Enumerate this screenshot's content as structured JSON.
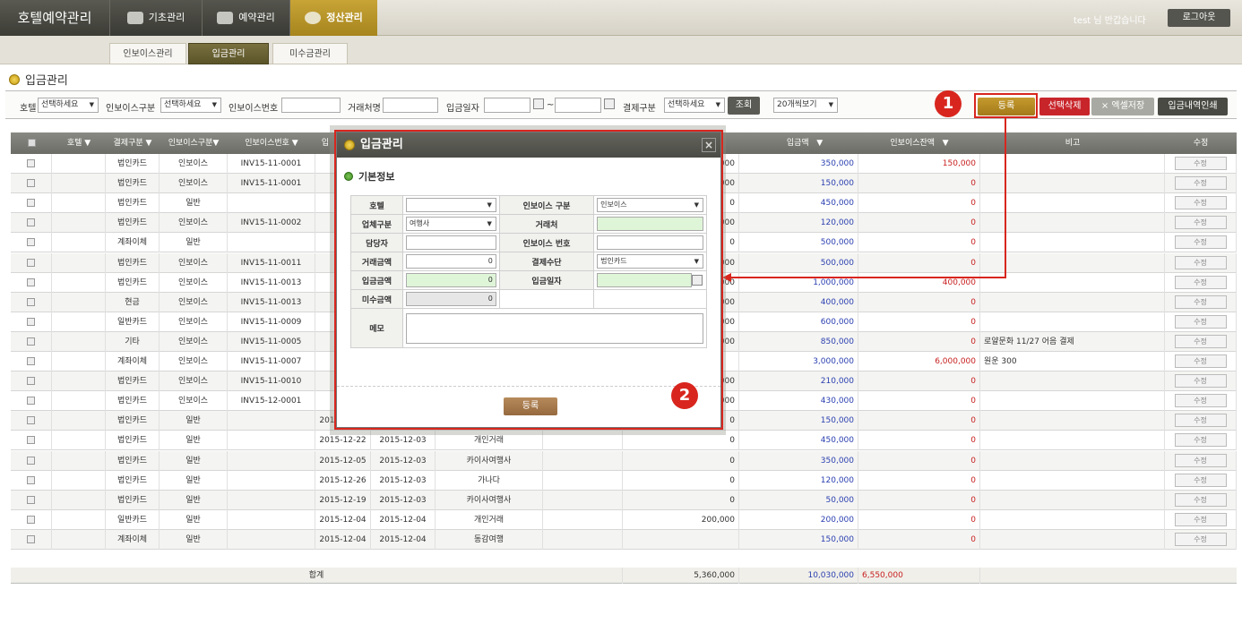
{
  "app": {
    "title": "호텔예약관리",
    "greeting": "test 님 반갑습니다",
    "logout": "로그아웃"
  },
  "topnav": [
    {
      "label": "기초관리",
      "icon": "gear-icon"
    },
    {
      "label": "예약관리",
      "icon": "bed-icon"
    },
    {
      "label": "정산관리",
      "icon": "coins-icon"
    }
  ],
  "subtabs": [
    "인보이스관리",
    "입금관리",
    "미수금관리"
  ],
  "page_title": "입금관리",
  "filters": {
    "hotel_label": "호텔",
    "hotel_value": "선택하세요",
    "invoice_type_label": "인보이스구분",
    "invoice_type_value": "선택하세요",
    "invoice_no_label": "인보이스번호",
    "partner_label": "거래처명",
    "date_label": "입금일자",
    "date_sep": "~",
    "pay_type_label": "결제구분",
    "pay_type_value": "선택하세요",
    "search_button": "조회",
    "page_size_value": "20개씩보기"
  },
  "actions": {
    "register": "등록",
    "delete_selected": "선택삭제",
    "excel": "× 엑셀저장",
    "print": "입금내역인쇄"
  },
  "annotations": {
    "one": "1",
    "two": "2"
  },
  "table": {
    "headers": [
      "호텔",
      "결제구분",
      "인보이스구분",
      "인보이스번호",
      "입",
      "입금액",
      "인보이스잔액",
      "비고",
      "수정"
    ],
    "rows": [
      {
        "pay": "법인카드",
        "inv": "인보이스",
        "no": "INV15-11-0001",
        "year": "201",
        "d2": "",
        "cust": "",
        "cat": "",
        "pre": "000",
        "amt": "350,000",
        "bal": "150,000",
        "note": ""
      },
      {
        "pay": "법인카드",
        "inv": "인보이스",
        "no": "INV15-11-0001",
        "year": "201",
        "d2": "",
        "cust": "",
        "cat": "",
        "pre": "000",
        "amt": "150,000",
        "bal": "0",
        "note": ""
      },
      {
        "pay": "법인카드",
        "inv": "일반",
        "no": "",
        "year": "201",
        "d2": "",
        "cust": "",
        "cat": "",
        "pre": "0",
        "amt": "450,000",
        "bal": "0",
        "note": ""
      },
      {
        "pay": "법인카드",
        "inv": "인보이스",
        "no": "INV15-11-0002",
        "year": "201",
        "d2": "",
        "cust": "",
        "cat": "",
        "pre": "000",
        "amt": "120,000",
        "bal": "0",
        "note": ""
      },
      {
        "pay": "계좌이체",
        "inv": "일반",
        "no": "",
        "year": "201",
        "d2": "",
        "cust": "",
        "cat": "",
        "pre": "0",
        "amt": "500,000",
        "bal": "0",
        "note": ""
      },
      {
        "pay": "법인카드",
        "inv": "인보이스",
        "no": "INV15-11-0011",
        "year": "201",
        "d2": "",
        "cust": "",
        "cat": "",
        "pre": "000",
        "amt": "500,000",
        "bal": "0",
        "note": ""
      },
      {
        "pay": "법인카드",
        "inv": "인보이스",
        "no": "INV15-11-0013",
        "year": "201",
        "d2": "",
        "cust": "",
        "cat": "",
        "pre": "000",
        "amt": "1,000,000",
        "bal": "400,000",
        "note": ""
      },
      {
        "pay": "현금",
        "inv": "인보이스",
        "no": "INV15-11-0013",
        "year": "201",
        "d2": "",
        "cust": "",
        "cat": "",
        "pre": "000",
        "amt": "400,000",
        "bal": "0",
        "note": ""
      },
      {
        "pay": "일반카드",
        "inv": "인보이스",
        "no": "INV15-11-0009",
        "year": "201",
        "d2": "",
        "cust": "",
        "cat": "",
        "pre": "000",
        "amt": "600,000",
        "bal": "0",
        "note": ""
      },
      {
        "pay": "기타",
        "inv": "인보이스",
        "no": "INV15-11-0005",
        "year": "201",
        "d2": "",
        "cust": "",
        "cat": "",
        "pre": "000",
        "amt": "850,000",
        "bal": "0",
        "note": "로얄문화 11/27 어음 결제"
      },
      {
        "pay": "계좌이체",
        "inv": "인보이스",
        "no": "INV15-11-0007",
        "year": "201",
        "d2": "",
        "cust": "",
        "cat": "",
        "pre": "",
        "amt": "3,000,000",
        "bal": "6,000,000",
        "note": "원운 300"
      },
      {
        "pay": "법인카드",
        "inv": "인보이스",
        "no": "INV15-11-0010",
        "year": "201",
        "d2": "",
        "cust": "",
        "cat": "",
        "pre": "000",
        "amt": "210,000",
        "bal": "0",
        "note": ""
      },
      {
        "pay": "법인카드",
        "inv": "인보이스",
        "no": "INV15-12-0001",
        "year": "201",
        "d2": "",
        "cust": "",
        "cat": "",
        "pre": "000",
        "amt": "430,000",
        "bal": "0",
        "note": ""
      },
      {
        "pay": "법인카드",
        "inv": "일반",
        "no": "",
        "year": "2015-12-26",
        "d2": "2015-12-03",
        "cust": "개인",
        "cat": "개인 입금",
        "pre": "0",
        "amt": "150,000",
        "bal": "0",
        "note": ""
      },
      {
        "pay": "법인카드",
        "inv": "일반",
        "no": "",
        "year": "2015-12-22",
        "d2": "2015-12-03",
        "cust": "개인거래",
        "cat": "",
        "pre": "0",
        "amt": "450,000",
        "bal": "0",
        "note": ""
      },
      {
        "pay": "법인카드",
        "inv": "일반",
        "no": "",
        "year": "2015-12-05",
        "d2": "2015-12-03",
        "cust": "카이사여행사",
        "cat": "",
        "pre": "0",
        "amt": "350,000",
        "bal": "0",
        "note": ""
      },
      {
        "pay": "법인카드",
        "inv": "일반",
        "no": "",
        "year": "2015-12-26",
        "d2": "2015-12-03",
        "cust": "가나다",
        "cat": "",
        "pre": "0",
        "amt": "120,000",
        "bal": "0",
        "note": ""
      },
      {
        "pay": "법인카드",
        "inv": "일반",
        "no": "",
        "year": "2015-12-19",
        "d2": "2015-12-03",
        "cust": "카이사여행사",
        "cat": "",
        "pre": "0",
        "amt": "50,000",
        "bal": "0",
        "note": ""
      },
      {
        "pay": "일반카드",
        "inv": "일반",
        "no": "",
        "year": "2015-12-04",
        "d2": "2015-12-04",
        "cust": "개인거래",
        "cat": "",
        "pre": "200,000",
        "amt": "200,000",
        "bal": "0",
        "note": ""
      },
      {
        "pay": "계좌이체",
        "inv": "일반",
        "no": "",
        "year": "2015-12-04",
        "d2": "2015-12-04",
        "cust": "동감여행",
        "cat": "",
        "pre": "",
        "amt": "150,000",
        "bal": "0",
        "note": ""
      }
    ],
    "edit_label": "수정",
    "total": {
      "label": "합계",
      "pre": "5,360,000",
      "amt": "10,030,000",
      "bal": "6,550,000"
    }
  },
  "modal": {
    "title": "입금관리",
    "close": "×",
    "section": "기본정보",
    "hotel_label": "호텔",
    "hotel_value": "",
    "invoice_type_label": "인보이스 구분",
    "invoice_type_value": "인보이스",
    "biz_type_label": "업체구분",
    "biz_type_value": "여행사",
    "partner_label": "거래처",
    "partner_value": "",
    "manager_label": "담당자",
    "manager_value": "",
    "invoice_no_label": "인보이스 번호",
    "invoice_no_value": "",
    "trade_amount_label": "거래금액",
    "trade_amount_value": "0",
    "pay_method_label": "결제수단",
    "pay_method_value": "법인카드",
    "deposit_amount_label": "입금금액",
    "deposit_amount_value": "0",
    "deposit_date_label": "입금일자",
    "deposit_date_value": "",
    "unpaid_label": "미수금액",
    "unpaid_value": "0",
    "memo_label": "메모",
    "register_button": "등록"
  },
  "colors": {
    "accent_gold": "#b8941f",
    "annotation_red": "#d8261e",
    "header_dark": "#4a4a44",
    "amount_blue": "#2a3fb0",
    "balance_red": "#c82020"
  }
}
